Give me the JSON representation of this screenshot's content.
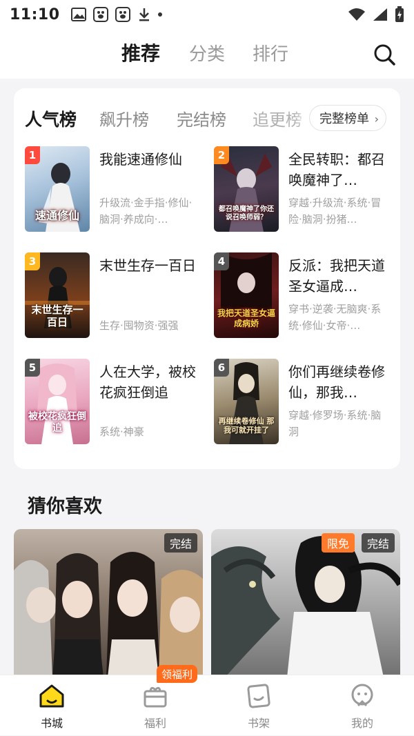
{
  "status_bar": {
    "time": "11:10"
  },
  "top_nav": {
    "tabs": [
      "推荐",
      "分类",
      "排行"
    ],
    "active": 0
  },
  "rank_card": {
    "tabs": [
      "人气榜",
      "飙升榜",
      "完结榜",
      "追更榜"
    ],
    "full_list_label": "完整榜单",
    "books": [
      {
        "rank": "1",
        "title": "我能速通修仙",
        "tags": "升级流·金手指·修仙·脑洞·养成向·…",
        "cover_text": "速通修仙",
        "rank_color": "#ff4a3d"
      },
      {
        "rank": "2",
        "title": "全民转职：都召唤魔神了…",
        "tags": "穿越·升级流·系统·冒险·脑洞·扮猪…",
        "cover_text": "都召唤魔神了你还说召唤师弱？",
        "rank_color": "#ff8a1f"
      },
      {
        "rank": "3",
        "title": "末世生存一百日",
        "tags": "生存·囤物资·强强",
        "cover_text": "末世生存一百日",
        "rank_color": "#ffb81f"
      },
      {
        "rank": "4",
        "title": "反派：我把天道圣女逼成…",
        "tags": "穿书·逆袭·无脑爽·系统·修仙·女帝·…",
        "cover_text": "我把天道圣女逼成病娇",
        "rank_color": "#555555"
      },
      {
        "rank": "5",
        "title": "人在大学，被校花疯狂倒追",
        "tags": "系统·神豪",
        "cover_text": "被校花疯狂倒追",
        "rank_color": "#555555"
      },
      {
        "rank": "6",
        "title": "你们再继续卷修仙，那我…",
        "tags": "穿越·修罗场·系统·脑洞",
        "cover_text": "再继续卷修仙 那我可就开挂了",
        "rank_color": "#555555"
      }
    ]
  },
  "guess": {
    "title": "猜你喜欢",
    "cards": [
      {
        "badges": [
          "完结"
        ]
      },
      {
        "badges": [
          "限免",
          "完结"
        ]
      }
    ]
  },
  "bottom_nav": {
    "items": [
      "书城",
      "福利",
      "书架",
      "我的"
    ],
    "active": 0,
    "welfare_badge": "领福利"
  },
  "colors": {
    "accent_yellow": "#ffe23a",
    "badge_orange": "#ff7a2a"
  }
}
